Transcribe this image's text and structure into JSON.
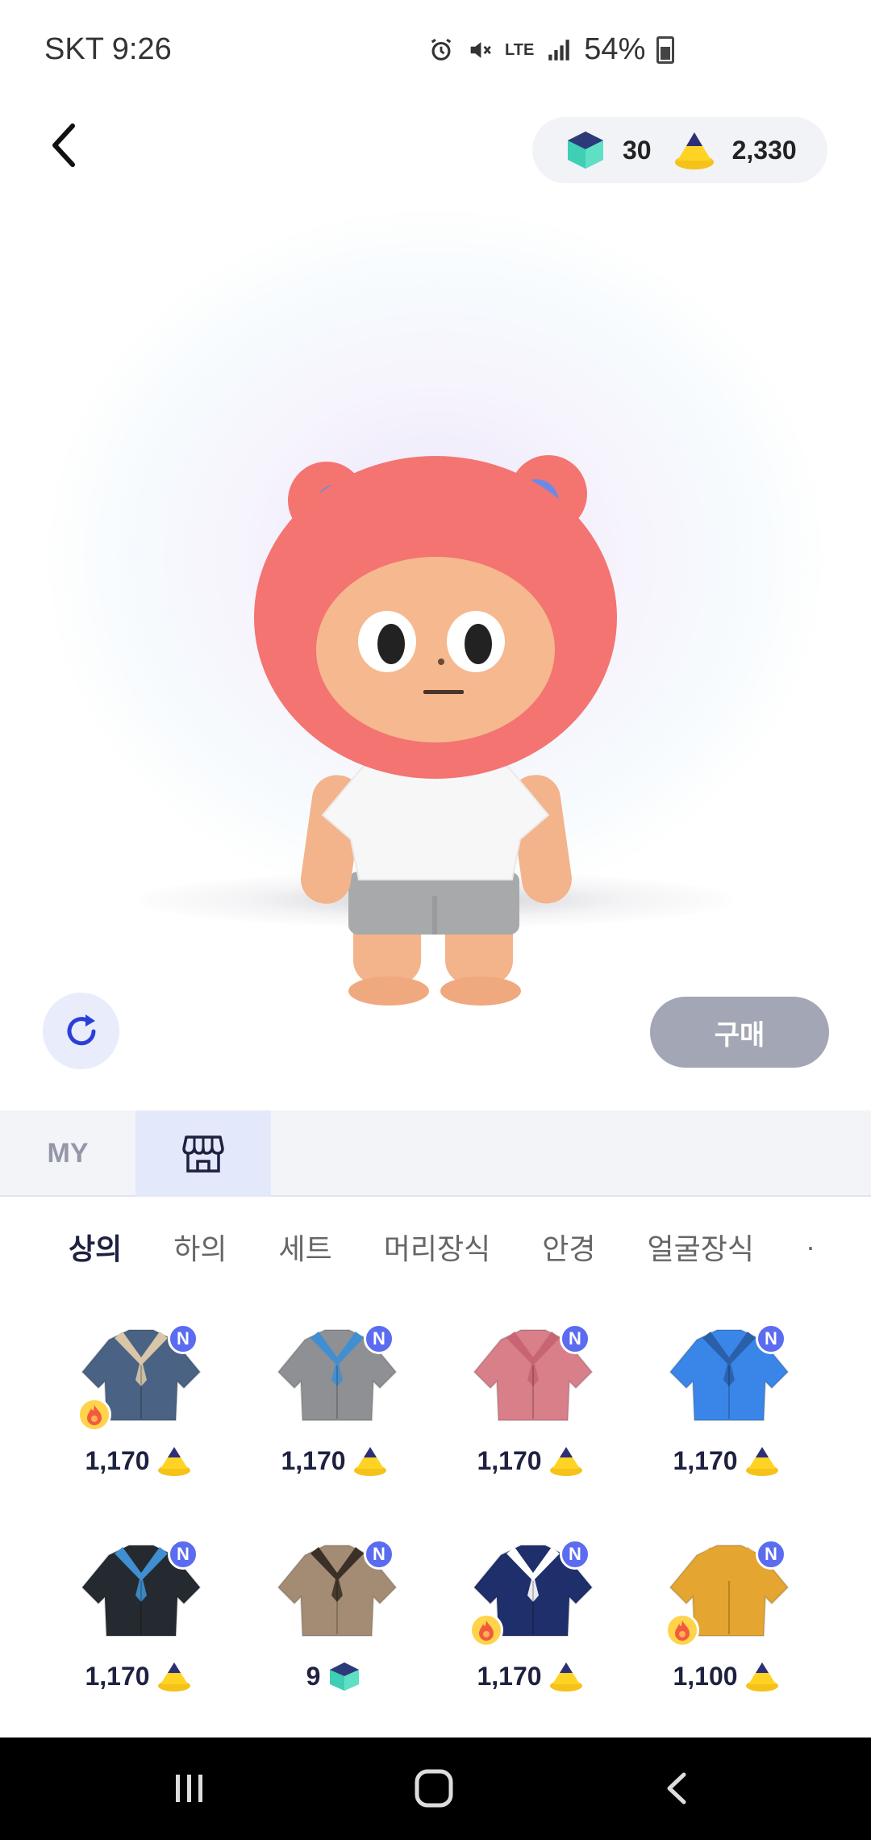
{
  "status_bar": {
    "carrier_time": "SKT 9:26",
    "network": "LTE",
    "battery": "54%",
    "icons": [
      "alarm-icon",
      "mute-icon",
      "lte-icon",
      "signal-icon",
      "battery-icon"
    ]
  },
  "header": {
    "back_icon": "chevron-left-icon",
    "currency": {
      "gems": "30",
      "cones": "2,330"
    }
  },
  "actions": {
    "refresh_icon": "refresh-icon",
    "buy_label": "구매"
  },
  "tabs": {
    "my_label": "MY",
    "shop_icon": "shop-icon"
  },
  "categories": [
    "상의",
    "하의",
    "세트",
    "머리장식",
    "안경",
    "얼굴장식"
  ],
  "active_category": "상의",
  "items": [
    {
      "price": "1,170",
      "currency": "cone",
      "color": "#4a6384",
      "collar": "#d9c6a8",
      "hot": true
    },
    {
      "price": "1,170",
      "currency": "cone",
      "color": "#8e9093",
      "collar": "#3f8fd2",
      "hot": false
    },
    {
      "price": "1,170",
      "currency": "cone",
      "color": "#d97f89",
      "collar": "#c76672",
      "hot": false
    },
    {
      "price": "1,170",
      "currency": "cone",
      "color": "#3a86e8",
      "collar": "#2a5fa9",
      "hot": false
    },
    {
      "price": "1,170",
      "currency": "cone",
      "color": "#252a30",
      "collar": "#3f8fd2",
      "hot": false
    },
    {
      "price": "9",
      "currency": "gem",
      "color": "#a48c74",
      "collar": "#3b3028",
      "hot": false
    },
    {
      "price": "1,170",
      "currency": "cone",
      "color": "#1f2f6b",
      "collar": "#ffffff",
      "hot": true
    },
    {
      "price": "1,100",
      "currency": "cone",
      "color": "#e4a531",
      "collar": "#e4a531",
      "hot": true
    }
  ],
  "badge_label": "N",
  "nav": {
    "recents_icon": "recents-icon",
    "home_icon": "home-icon",
    "back_icon": "back-icon"
  },
  "colors": {
    "accent": "#5b6cf0",
    "buy_disabled": "#a3a6b4",
    "tab_selected_bg": "#e4e8fb"
  }
}
